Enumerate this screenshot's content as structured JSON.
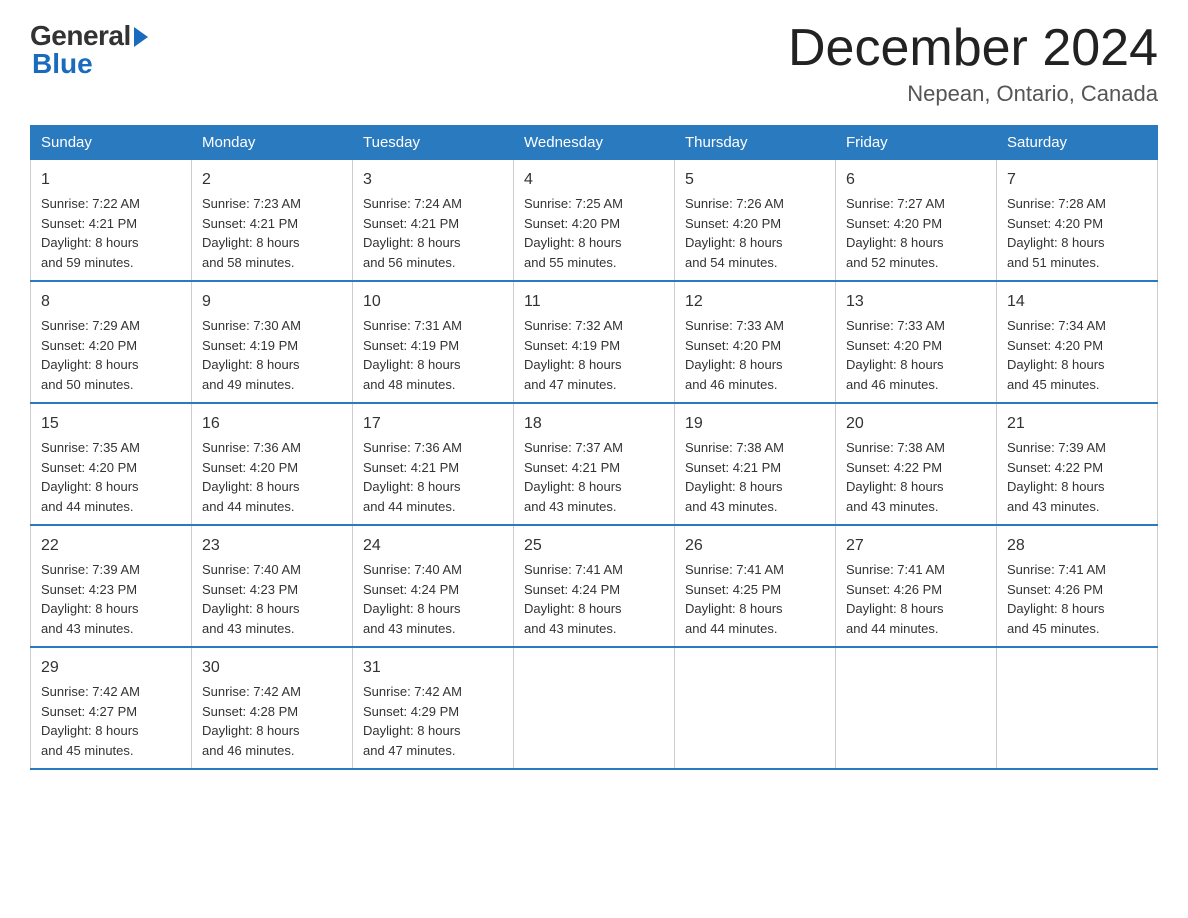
{
  "logo": {
    "general": "General",
    "blue": "Blue"
  },
  "title": {
    "month_year": "December 2024",
    "location": "Nepean, Ontario, Canada"
  },
  "days_of_week": [
    "Sunday",
    "Monday",
    "Tuesday",
    "Wednesday",
    "Thursday",
    "Friday",
    "Saturday"
  ],
  "weeks": [
    [
      {
        "day": "1",
        "sunrise": "7:22 AM",
        "sunset": "4:21 PM",
        "daylight": "8 hours and 59 minutes."
      },
      {
        "day": "2",
        "sunrise": "7:23 AM",
        "sunset": "4:21 PM",
        "daylight": "8 hours and 58 minutes."
      },
      {
        "day": "3",
        "sunrise": "7:24 AM",
        "sunset": "4:21 PM",
        "daylight": "8 hours and 56 minutes."
      },
      {
        "day": "4",
        "sunrise": "7:25 AM",
        "sunset": "4:20 PM",
        "daylight": "8 hours and 55 minutes."
      },
      {
        "day": "5",
        "sunrise": "7:26 AM",
        "sunset": "4:20 PM",
        "daylight": "8 hours and 54 minutes."
      },
      {
        "day": "6",
        "sunrise": "7:27 AM",
        "sunset": "4:20 PM",
        "daylight": "8 hours and 52 minutes."
      },
      {
        "day": "7",
        "sunrise": "7:28 AM",
        "sunset": "4:20 PM",
        "daylight": "8 hours and 51 minutes."
      }
    ],
    [
      {
        "day": "8",
        "sunrise": "7:29 AM",
        "sunset": "4:20 PM",
        "daylight": "8 hours and 50 minutes."
      },
      {
        "day": "9",
        "sunrise": "7:30 AM",
        "sunset": "4:19 PM",
        "daylight": "8 hours and 49 minutes."
      },
      {
        "day": "10",
        "sunrise": "7:31 AM",
        "sunset": "4:19 PM",
        "daylight": "8 hours and 48 minutes."
      },
      {
        "day": "11",
        "sunrise": "7:32 AM",
        "sunset": "4:19 PM",
        "daylight": "8 hours and 47 minutes."
      },
      {
        "day": "12",
        "sunrise": "7:33 AM",
        "sunset": "4:20 PM",
        "daylight": "8 hours and 46 minutes."
      },
      {
        "day": "13",
        "sunrise": "7:33 AM",
        "sunset": "4:20 PM",
        "daylight": "8 hours and 46 minutes."
      },
      {
        "day": "14",
        "sunrise": "7:34 AM",
        "sunset": "4:20 PM",
        "daylight": "8 hours and 45 minutes."
      }
    ],
    [
      {
        "day": "15",
        "sunrise": "7:35 AM",
        "sunset": "4:20 PM",
        "daylight": "8 hours and 44 minutes."
      },
      {
        "day": "16",
        "sunrise": "7:36 AM",
        "sunset": "4:20 PM",
        "daylight": "8 hours and 44 minutes."
      },
      {
        "day": "17",
        "sunrise": "7:36 AM",
        "sunset": "4:21 PM",
        "daylight": "8 hours and 44 minutes."
      },
      {
        "day": "18",
        "sunrise": "7:37 AM",
        "sunset": "4:21 PM",
        "daylight": "8 hours and 43 minutes."
      },
      {
        "day": "19",
        "sunrise": "7:38 AM",
        "sunset": "4:21 PM",
        "daylight": "8 hours and 43 minutes."
      },
      {
        "day": "20",
        "sunrise": "7:38 AM",
        "sunset": "4:22 PM",
        "daylight": "8 hours and 43 minutes."
      },
      {
        "day": "21",
        "sunrise": "7:39 AM",
        "sunset": "4:22 PM",
        "daylight": "8 hours and 43 minutes."
      }
    ],
    [
      {
        "day": "22",
        "sunrise": "7:39 AM",
        "sunset": "4:23 PM",
        "daylight": "8 hours and 43 minutes."
      },
      {
        "day": "23",
        "sunrise": "7:40 AM",
        "sunset": "4:23 PM",
        "daylight": "8 hours and 43 minutes."
      },
      {
        "day": "24",
        "sunrise": "7:40 AM",
        "sunset": "4:24 PM",
        "daylight": "8 hours and 43 minutes."
      },
      {
        "day": "25",
        "sunrise": "7:41 AM",
        "sunset": "4:24 PM",
        "daylight": "8 hours and 43 minutes."
      },
      {
        "day": "26",
        "sunrise": "7:41 AM",
        "sunset": "4:25 PM",
        "daylight": "8 hours and 44 minutes."
      },
      {
        "day": "27",
        "sunrise": "7:41 AM",
        "sunset": "4:26 PM",
        "daylight": "8 hours and 44 minutes."
      },
      {
        "day": "28",
        "sunrise": "7:41 AM",
        "sunset": "4:26 PM",
        "daylight": "8 hours and 45 minutes."
      }
    ],
    [
      {
        "day": "29",
        "sunrise": "7:42 AM",
        "sunset": "4:27 PM",
        "daylight": "8 hours and 45 minutes."
      },
      {
        "day": "30",
        "sunrise": "7:42 AM",
        "sunset": "4:28 PM",
        "daylight": "8 hours and 46 minutes."
      },
      {
        "day": "31",
        "sunrise": "7:42 AM",
        "sunset": "4:29 PM",
        "daylight": "8 hours and 47 minutes."
      },
      null,
      null,
      null,
      null
    ]
  ],
  "labels": {
    "sunrise": "Sunrise:",
    "sunset": "Sunset:",
    "daylight": "Daylight:"
  }
}
